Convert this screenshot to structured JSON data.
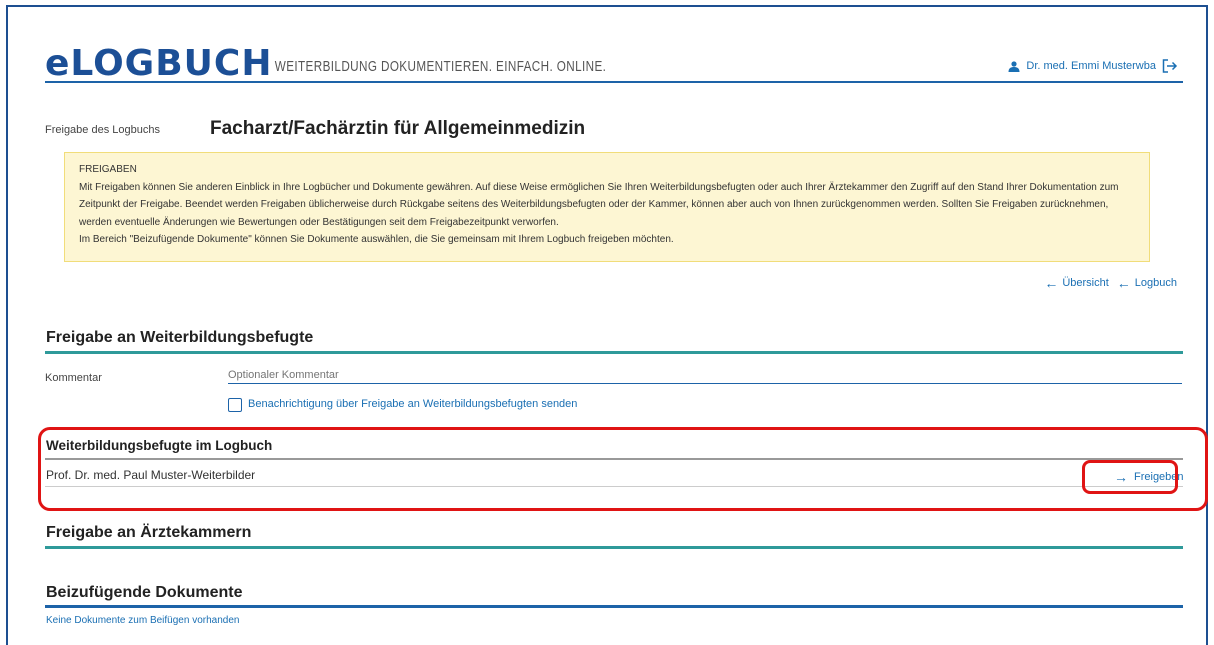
{
  "header": {
    "logo": "eLOGBUCH",
    "tagline": "WEITERBILDUNG DOKUMENTIEREN. EINFACH. ONLINE.",
    "user_name": "Dr. med. Emmi Musterwba"
  },
  "page": {
    "section_label": "Freigabe des Logbuchs",
    "title": "Facharzt/Fachärztin für Allgemeinmedizin"
  },
  "info": {
    "title": "FREIGABEN",
    "line1": "Mit Freigaben können Sie anderen Einblick in Ihre Logbücher und Dokumente gewähren. Auf diese Weise ermöglichen Sie Ihren Weiterbildungsbefugten oder auch Ihrer Ärztekammer den Zugriff auf den Stand Ihrer Dokumentation zum",
    "line2": "Zeitpunkt der Freigabe. Beendet werden Freigaben üblicherweise durch Rückgabe seitens des Weiterbildungsbefugten oder der Kammer, können aber auch von Ihnen zurückgenommen werden. Sollten Sie Freigaben zurücknehmen,",
    "line3": "werden eventuelle Änderungen wie Bewertungen oder Bestätigungen seit dem Freigabezeitpunkt verworfen.",
    "line4": "Im Bereich \"Beizufügende Dokumente\" können Sie Dokumente auswählen, die Sie gemeinsam mit Ihrem Logbuch freigeben möchten."
  },
  "nav": {
    "overview": "Übersicht",
    "logbook": "Logbuch"
  },
  "section_wb": {
    "title": "Freigabe an Weiterbildungsbefugte",
    "comment_label": "Kommentar",
    "comment_placeholder": "Optionaler Kommentar",
    "notify_label": "Benachrichtigung über Freigabe an Weiterbildungsbefugten senden"
  },
  "wb_list": {
    "title": "Weiterbildungsbefugte im Logbuch",
    "rows": [
      {
        "name": "Prof. Dr. med. Paul Muster-Weiterbilder",
        "action": "Freigeben"
      }
    ]
  },
  "section_kammer": {
    "title": "Freigabe an Ärztekammern"
  },
  "section_docs": {
    "title": "Beizufügende Dokumente",
    "empty": "Keine Dokumente zum Beifügen vorhanden"
  },
  "colors": {
    "brand_blue": "#1c4f96",
    "teal": "#2e9a9a",
    "highlight_red": "#e01414",
    "info_bg": "#fdf6d3"
  }
}
